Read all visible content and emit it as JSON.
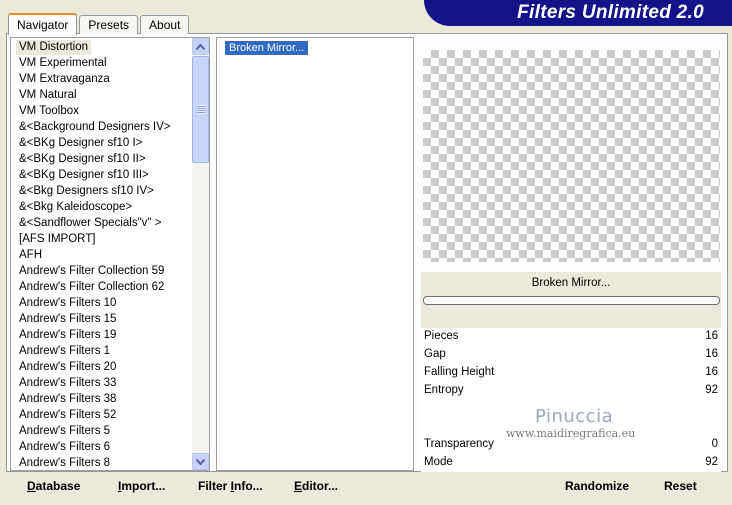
{
  "tabs": [
    {
      "label": "Navigator",
      "active": true
    },
    {
      "label": "Presets",
      "active": false
    },
    {
      "label": "About",
      "active": false
    }
  ],
  "banner": {
    "title": "Filters Unlimited 2.0"
  },
  "categories": [
    "VM Distortion",
    "VM Experimental",
    "VM Extravaganza",
    "VM Natural",
    "VM Toolbox",
    "&<Background Designers IV>",
    "&<BKg Designer sf10 I>",
    "&<BKg Designer sf10 II>",
    "&<BKg Designer sf10 III>",
    "&<Bkg Designers sf10 IV>",
    "&<Bkg Kaleidoscope>",
    "&<Sandflower Specials\"v\" >",
    "[AFS IMPORT]",
    "AFH",
    "Andrew's Filter Collection 59",
    "Andrew's Filter Collection 62",
    "Andrew's Filters 10",
    "Andrew's Filters 15",
    "Andrew's Filters 19",
    "Andrew's Filters 1",
    "Andrew's Filters 20",
    "Andrew's Filters 33",
    "Andrew's Filters 38",
    "Andrew's Filters 52",
    "Andrew's Filters 5",
    "Andrew's Filters 6",
    "Andrew's Filters 8"
  ],
  "selected_category": "VM Distortion",
  "filters": [
    "Broken Mirror..."
  ],
  "filter_name": "Broken Mirror...",
  "params": [
    {
      "label": "Pieces",
      "value": "16"
    },
    {
      "label": "Gap",
      "value": "16"
    },
    {
      "label": "Falling Height",
      "value": "16"
    },
    {
      "label": "Entropy",
      "value": "92"
    },
    {
      "label": "Transparency",
      "value": "0"
    },
    {
      "label": "Mode",
      "value": "92"
    }
  ],
  "watermark": {
    "name": "Pinuccia",
    "site": "www.maidiregrafica.eu"
  },
  "buttons": {
    "database": {
      "mnemonic": "D",
      "rest": "atabase"
    },
    "import": {
      "mnemonic": "I",
      "rest": "mport..."
    },
    "filter_info": {
      "pre": "Filter ",
      "mnemonic": "I",
      "rest": "nfo..."
    },
    "editor": {
      "mnemonic": "E",
      "rest": "ditor..."
    },
    "randomize": {
      "label": "Randomize"
    },
    "reset": {
      "label": "Reset"
    }
  }
}
